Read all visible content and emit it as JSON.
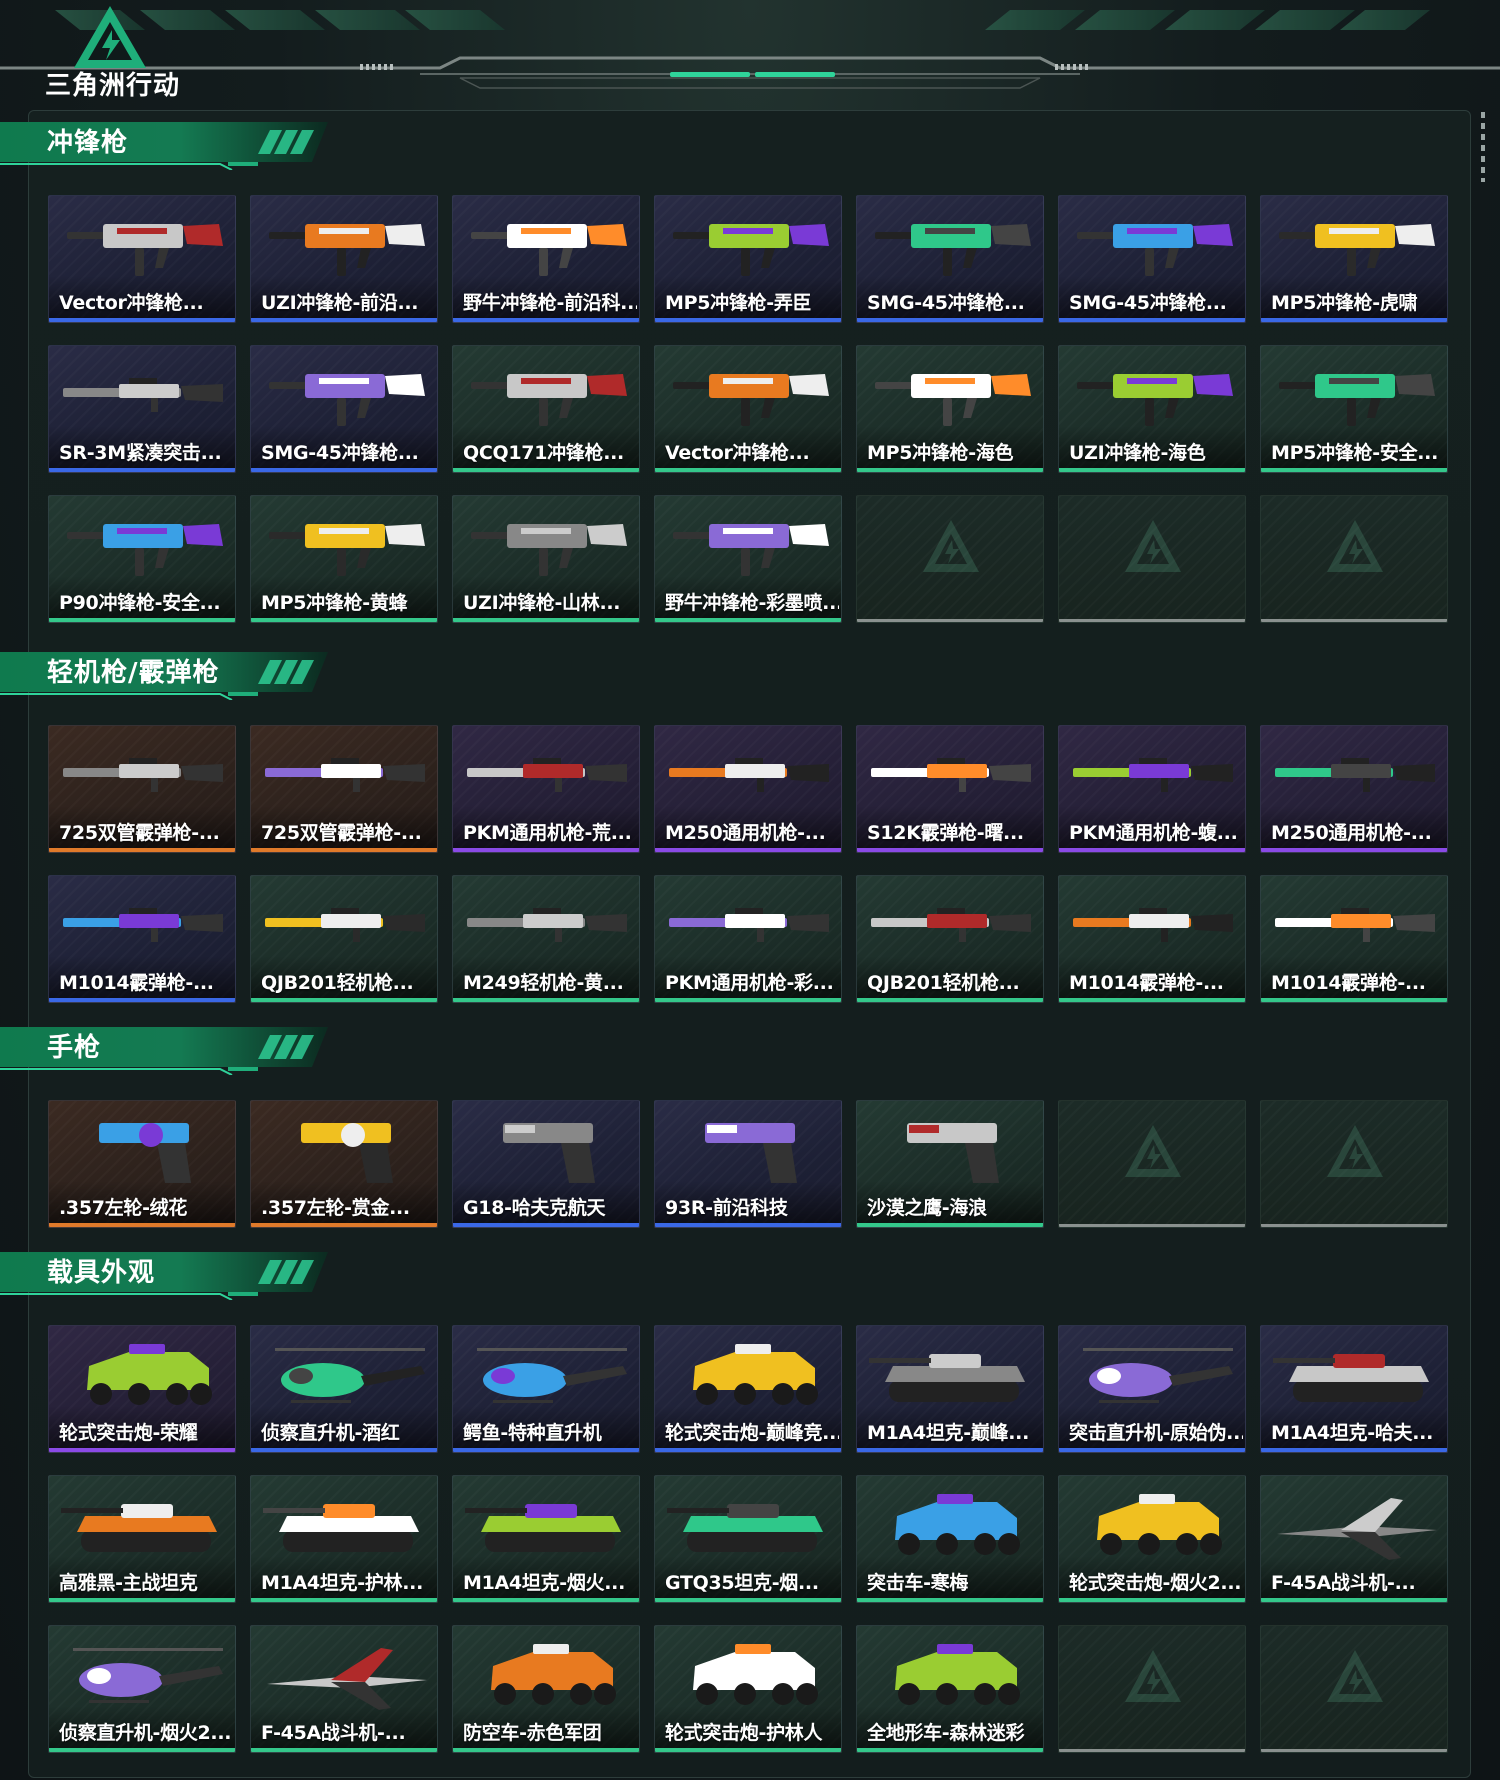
{
  "app": {
    "logo_text": "三角洲行动",
    "logo_icon": "delta-triangle-logo-icon",
    "accent_color": "#1fae7a"
  },
  "sections": [
    {
      "title": "冲锋枪",
      "items": [
        {
          "name": "Vector冲锋枪...",
          "rarity": "blue",
          "icon": "smg-icon"
        },
        {
          "name": "UZI冲锋枪-前沿...",
          "rarity": "blue",
          "icon": "smg-icon"
        },
        {
          "name": "野牛冲锋枪-前沿科...",
          "rarity": "blue",
          "icon": "smg-icon"
        },
        {
          "name": "MP5冲锋枪-弄臣",
          "rarity": "blue",
          "icon": "smg-icon"
        },
        {
          "name": "SMG-45冲锋枪...",
          "rarity": "blue",
          "icon": "smg-icon"
        },
        {
          "name": "SMG-45冲锋枪...",
          "rarity": "blue",
          "icon": "smg-icon"
        },
        {
          "name": "MP5冲锋枪-虎啸",
          "rarity": "blue",
          "icon": "smg-icon"
        },
        {
          "name": "SR-3M紧凑突击...",
          "rarity": "blue",
          "icon": "rifle-icon"
        },
        {
          "name": "SMG-45冲锋枪...",
          "rarity": "blue",
          "icon": "smg-icon"
        },
        {
          "name": "QCQ171冲锋枪...",
          "rarity": "green",
          "icon": "smg-icon"
        },
        {
          "name": "Vector冲锋枪...",
          "rarity": "green",
          "icon": "smg-icon"
        },
        {
          "name": "MP5冲锋枪-海色",
          "rarity": "green",
          "icon": "smg-icon"
        },
        {
          "name": "UZI冲锋枪-海色",
          "rarity": "green",
          "icon": "smg-icon"
        },
        {
          "name": "MP5冲锋枪-安全...",
          "rarity": "green",
          "icon": "smg-icon"
        },
        {
          "name": "P90冲锋枪-安全...",
          "rarity": "green",
          "icon": "smg-icon"
        },
        {
          "name": "MP5冲锋枪-黄蜂",
          "rarity": "green",
          "icon": "smg-icon"
        },
        {
          "name": "UZI冲锋枪-山林...",
          "rarity": "green",
          "icon": "smg-icon"
        },
        {
          "name": "野牛冲锋枪-彩墨喷...",
          "rarity": "green",
          "icon": "smg-icon"
        },
        {
          "name": "",
          "rarity": "empty",
          "icon": "empty-slot-icon"
        },
        {
          "name": "",
          "rarity": "empty",
          "icon": "empty-slot-icon"
        },
        {
          "name": "",
          "rarity": "empty",
          "icon": "empty-slot-icon"
        }
      ]
    },
    {
      "title": "轻机枪/霰弹枪",
      "items": [
        {
          "name": "725双管霰弹枪-...",
          "rarity": "orange",
          "icon": "shotgun-icon"
        },
        {
          "name": "725双管霰弹枪-...",
          "rarity": "orange",
          "icon": "shotgun-icon"
        },
        {
          "name": "PKM通用机枪-荒...",
          "rarity": "purple",
          "icon": "lmg-icon"
        },
        {
          "name": "M250通用机枪-...",
          "rarity": "purple",
          "icon": "lmg-icon"
        },
        {
          "name": "S12K霰弹枪-曙...",
          "rarity": "purple",
          "icon": "shotgun-icon"
        },
        {
          "name": "PKM通用机枪-蝮...",
          "rarity": "purple",
          "icon": "lmg-icon"
        },
        {
          "name": "M250通用机枪-...",
          "rarity": "purple",
          "icon": "lmg-icon"
        },
        {
          "name": "M1014霰弹枪-...",
          "rarity": "blue",
          "icon": "shotgun-icon"
        },
        {
          "name": "QJB201轻机枪...",
          "rarity": "green",
          "icon": "lmg-icon"
        },
        {
          "name": "M249轻机枪-黄...",
          "rarity": "green",
          "icon": "lmg-icon"
        },
        {
          "name": "PKM通用机枪-彩...",
          "rarity": "green",
          "icon": "lmg-icon"
        },
        {
          "name": "QJB201轻机枪...",
          "rarity": "green",
          "icon": "lmg-icon"
        },
        {
          "name": "M1014霰弹枪-...",
          "rarity": "green",
          "icon": "shotgun-icon"
        },
        {
          "name": "M1014霰弹枪-...",
          "rarity": "green",
          "icon": "shotgun-icon"
        }
      ]
    },
    {
      "title": "手枪",
      "items": [
        {
          "name": ".357左轮-绒花",
          "rarity": "orange",
          "icon": "revolver-icon"
        },
        {
          "name": ".357左轮-赏金...",
          "rarity": "orange",
          "icon": "revolver-icon"
        },
        {
          "name": "G18-哈夫克航天",
          "rarity": "blue",
          "icon": "pistol-icon"
        },
        {
          "name": "93R-前沿科技",
          "rarity": "blue",
          "icon": "pistol-icon"
        },
        {
          "name": "沙漠之鹰-海浪",
          "rarity": "green",
          "icon": "pistol-icon"
        },
        {
          "name": "",
          "rarity": "empty",
          "icon": "empty-slot-icon"
        },
        {
          "name": "",
          "rarity": "empty",
          "icon": "empty-slot-icon"
        }
      ]
    },
    {
      "title": "载具外观",
      "items": [
        {
          "name": "轮式突击炮-荣耀",
          "rarity": "purple",
          "icon": "armored-car-icon"
        },
        {
          "name": "侦察直升机-酒红",
          "rarity": "blue",
          "icon": "helicopter-icon"
        },
        {
          "name": "鳄鱼-特种直升机",
          "rarity": "blue",
          "icon": "helicopter-icon"
        },
        {
          "name": "轮式突击炮-巅峰竞...",
          "rarity": "blue",
          "icon": "armored-car-icon"
        },
        {
          "name": "M1A4坦克-巅峰...",
          "rarity": "blue",
          "icon": "tank-icon"
        },
        {
          "name": "突击直升机-原始伪...",
          "rarity": "blue",
          "icon": "helicopter-icon"
        },
        {
          "name": "M1A4坦克-哈夫...",
          "rarity": "blue",
          "icon": "tank-icon"
        },
        {
          "name": "高雅黑-主战坦克",
          "rarity": "green",
          "icon": "tank-icon"
        },
        {
          "name": "M1A4坦克-护林...",
          "rarity": "green",
          "icon": "tank-icon"
        },
        {
          "name": "M1A4坦克-烟火...",
          "rarity": "green",
          "icon": "tank-icon"
        },
        {
          "name": "GTQ35坦克-烟...",
          "rarity": "green",
          "icon": "tank-icon"
        },
        {
          "name": "突击车-寒梅",
          "rarity": "green",
          "icon": "armored-car-icon"
        },
        {
          "name": "轮式突击炮-烟火2...",
          "rarity": "green",
          "icon": "armored-car-icon"
        },
        {
          "name": "F-45A战斗机-...",
          "rarity": "green",
          "icon": "jet-icon"
        },
        {
          "name": "侦察直升机-烟火2...",
          "rarity": "green",
          "icon": "helicopter-icon"
        },
        {
          "name": "F-45A战斗机-...",
          "rarity": "green",
          "icon": "jet-icon"
        },
        {
          "name": "防空车-赤色军团",
          "rarity": "green",
          "icon": "armored-car-icon"
        },
        {
          "name": "轮式突击炮-护林人",
          "rarity": "green",
          "icon": "armored-car-icon"
        },
        {
          "name": "全地形车-森林迷彩",
          "rarity": "green",
          "icon": "atv-icon"
        },
        {
          "name": "",
          "rarity": "empty",
          "icon": "empty-slot-icon"
        },
        {
          "name": "",
          "rarity": "empty",
          "icon": "empty-slot-icon"
        }
      ]
    }
  ]
}
